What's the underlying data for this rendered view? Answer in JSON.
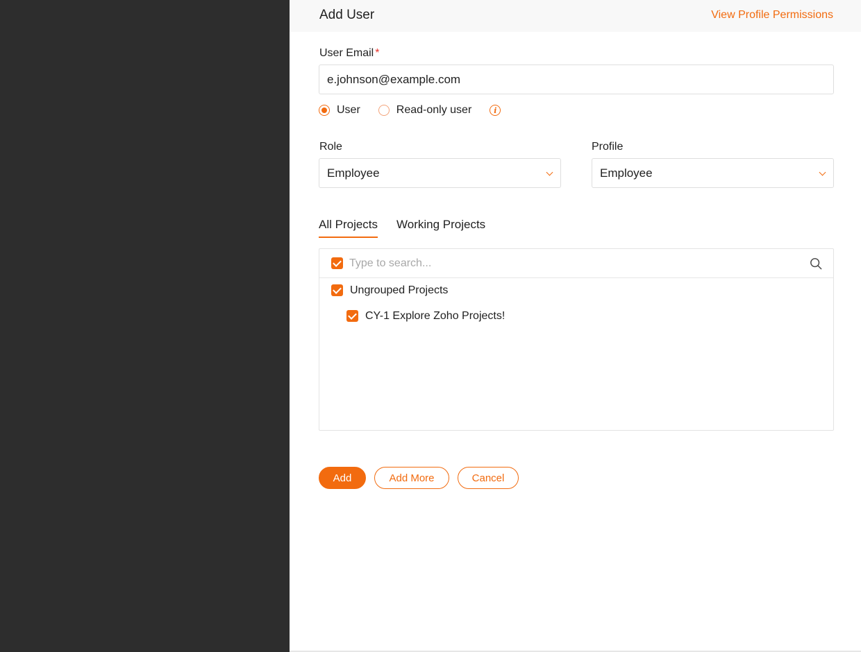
{
  "header": {
    "title": "Add User",
    "view_permissions_link": "View Profile Permissions"
  },
  "form": {
    "email_label": "User Email",
    "email_required_mark": "*",
    "email_value": "e.johnson@example.com",
    "user_type": {
      "options": [
        "User",
        "Read-only user"
      ],
      "selected": "User"
    },
    "role": {
      "label": "Role",
      "value": "Employee"
    },
    "profile": {
      "label": "Profile",
      "value": "Employee"
    }
  },
  "projects": {
    "tabs": [
      "All Projects",
      "Working Projects"
    ],
    "active_tab": "All Projects",
    "search_placeholder": "Type to search...",
    "select_all_checked": true,
    "groups": [
      {
        "name": "Ungrouped Projects",
        "checked": true,
        "items": [
          {
            "name": "CY-1 Explore Zoho Projects!",
            "checked": true
          }
        ]
      }
    ]
  },
  "actions": {
    "add": "Add",
    "add_more": "Add More",
    "cancel": "Cancel"
  },
  "colors": {
    "accent": "#f26b0f",
    "overlay": "#2d2d2d",
    "required": "#e8332c"
  }
}
